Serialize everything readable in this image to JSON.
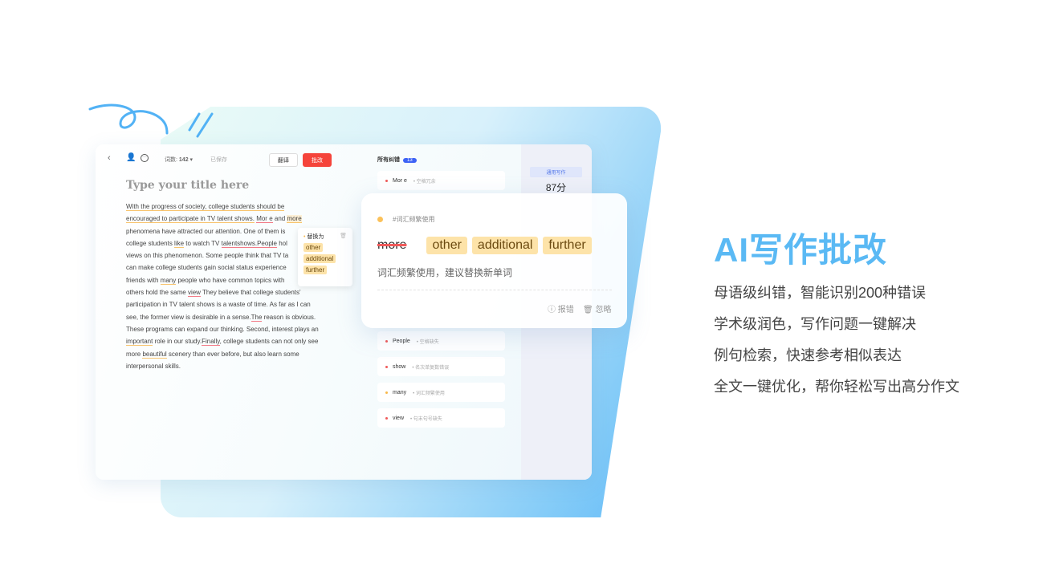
{
  "toolbar": {
    "word_count_label": "词数:",
    "word_count": "142",
    "saved": "已保存",
    "translate": "翻译",
    "correct": "批改"
  },
  "editor": {
    "title_placeholder": "Type your title here",
    "lines": [
      [
        [
          "With the progress of society, college students should be",
          "o"
        ]
      ],
      [
        [
          "encouraged to participate in TV talent shows.",
          "o"
        ],
        [
          " ",
          ""
        ],
        [
          "Mor e",
          "r"
        ],
        [
          " and ",
          ""
        ],
        [
          "more",
          "h"
        ]
      ],
      [
        [
          "phenomena have attracted our attention. One of them is",
          ""
        ]
      ],
      [
        [
          "college students ",
          ""
        ],
        [
          "like",
          "o"
        ],
        [
          " to watch TV ",
          ""
        ],
        [
          "talentshows.",
          "r"
        ],
        [
          "People",
          "r"
        ],
        [
          " hol",
          ""
        ]
      ],
      [
        [
          "views on this phenomenon. Some people think that TV ta",
          ""
        ]
      ],
      [
        [
          "can make college students gain social status experience",
          ""
        ]
      ],
      [
        [
          "friends with ",
          ""
        ],
        [
          "many",
          "o"
        ],
        [
          " people who have common topics with",
          ""
        ]
      ],
      [
        [
          "others hold the same ",
          ""
        ],
        [
          "view",
          "r"
        ],
        [
          " They believe that college students'",
          ""
        ]
      ],
      [
        [
          "participation in TV talent shows is a waste of time. As far as I can",
          ""
        ]
      ],
      [
        [
          "see, the former view is desirable in a sense.",
          ""
        ],
        [
          "The",
          "r"
        ],
        [
          " reason is obvious.",
          ""
        ]
      ],
      [
        [
          "These programs can expand our thinking. Second, interest plays an",
          ""
        ]
      ],
      [
        [
          "important",
          "o"
        ],
        [
          " role in our study.",
          ""
        ],
        [
          "Finally",
          "r"
        ],
        [
          ", college students can not only see",
          ""
        ]
      ],
      [
        [
          "more ",
          ""
        ],
        [
          "beautiful",
          "o"
        ],
        [
          " scenery than ever before, but also learn some",
          ""
        ]
      ],
      [
        [
          "interpersonal skills.",
          ""
        ]
      ]
    ]
  },
  "suggestion": {
    "label": "替换为",
    "options": [
      "other",
      "additional",
      "further"
    ]
  },
  "errors": {
    "header": "所有纠错",
    "count": "13",
    "items": [
      {
        "word": "Mor e",
        "category": "空格冗余",
        "color": "#f05a5a"
      },
      {
        "word": "People",
        "category": "空格缺失",
        "color": "#f05a5a"
      },
      {
        "word": "show",
        "category": "名次单复数错误",
        "color": "#f05a5a"
      },
      {
        "word": "many",
        "category": "词汇频繁使用",
        "color": "#f8b84a"
      },
      {
        "word": "view",
        "category": "句末句号缺失",
        "color": "#f05a5a"
      }
    ]
  },
  "score": {
    "tag": "通用写作",
    "value": "87分"
  },
  "popup": {
    "tag": "#词汇频繁使用",
    "original": "more",
    "options": [
      "other",
      "additional",
      "further"
    ],
    "desc": "词汇频繁使用，建议替换新单词",
    "report": "报错",
    "ignore": "忽略"
  },
  "promo": {
    "title": "AI写作批改",
    "features": [
      "母语级纠错，智能识别200种错误",
      "学术级润色，写作问题一键解决",
      "例句检索，快速参考相似表达",
      "全文一键优化，帮你轻松写出高分作文"
    ]
  },
  "colors": {
    "accent": "#5ab9f4",
    "correct_button": "#f5443b",
    "badge": "#3d63f5",
    "chip": "#fde3a9"
  }
}
